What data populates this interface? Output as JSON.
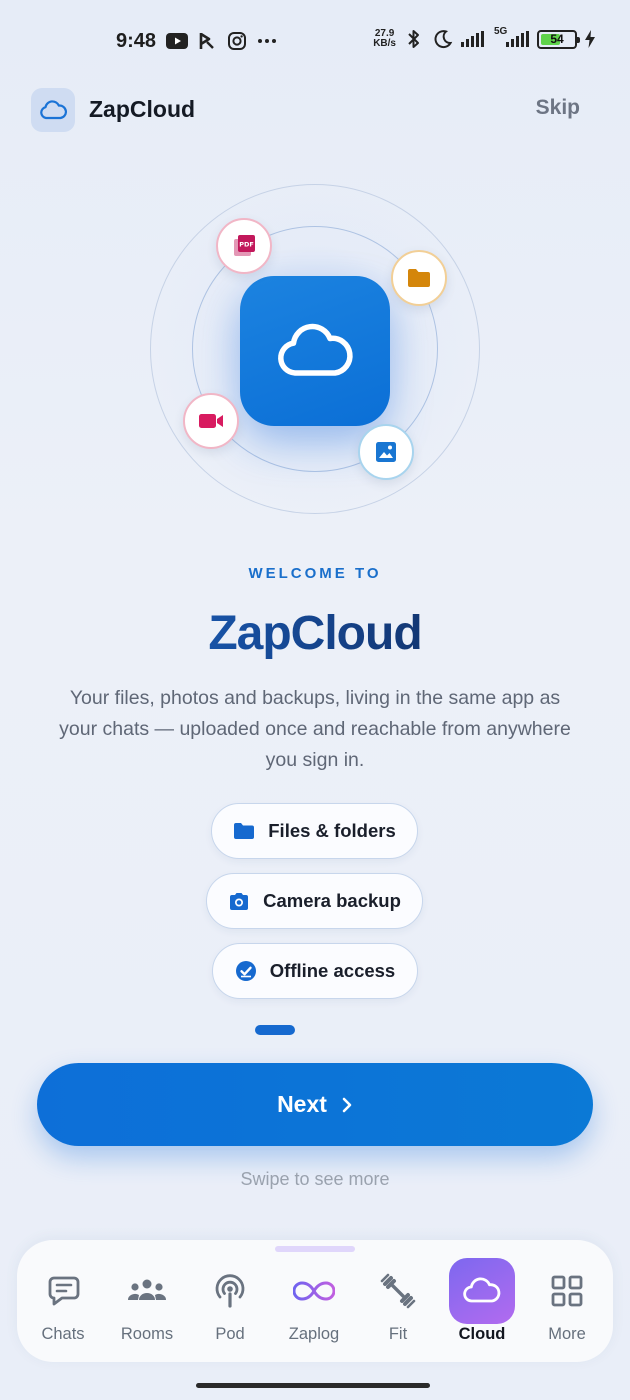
{
  "status_bar": {
    "time": "9:48",
    "left_icons": [
      "youtube-icon",
      "pay-icon",
      "instagram-icon",
      "more-dots-icon"
    ],
    "net_speed_value": "27.9",
    "net_speed_unit": "KB/s",
    "network": "5G",
    "battery_level": "54"
  },
  "header": {
    "app_name": "ZapCloud",
    "skip_label": "Skip",
    "logo_icon": "cloud-icon"
  },
  "hero": {
    "center_icon": "cloud-icon",
    "badges": [
      "pdf-icon",
      "folder-icon",
      "video-icon",
      "image-icon"
    ]
  },
  "welcome": {
    "eyebrow": "WELCOME TO",
    "title": "ZapCloud",
    "description": "Your files, photos and backups, living in the same app as your chats — uploaded once and reachable from anywhere you sign in."
  },
  "features": [
    {
      "label": "Files & folders",
      "icon": "folder-icon"
    },
    {
      "label": "Camera backup",
      "icon": "camera-icon"
    },
    {
      "label": "Offline access",
      "icon": "check-circle-icon"
    }
  ],
  "pager": {
    "current": 1
  },
  "cta": {
    "next_label": "Next",
    "swipe_hint": "Swipe to see more"
  },
  "bottom_nav": {
    "items": [
      {
        "label": "Chats",
        "icon": "chat-icon"
      },
      {
        "label": "Rooms",
        "icon": "people-icon"
      },
      {
        "label": "Pod",
        "icon": "podcast-icon"
      },
      {
        "label": "Zaplog",
        "icon": "infinity-icon"
      },
      {
        "label": "Fit",
        "icon": "dumbbell-icon"
      },
      {
        "label": "Cloud",
        "icon": "cloud-icon",
        "active": true
      },
      {
        "label": "More",
        "icon": "grid-icon"
      }
    ]
  },
  "colors": {
    "accent": "#1669cf",
    "nav_active": "#8f6aef",
    "pdf": "#c2185b",
    "folder": "#d4860b",
    "video": "#d81b60",
    "image": "#1976d2"
  }
}
